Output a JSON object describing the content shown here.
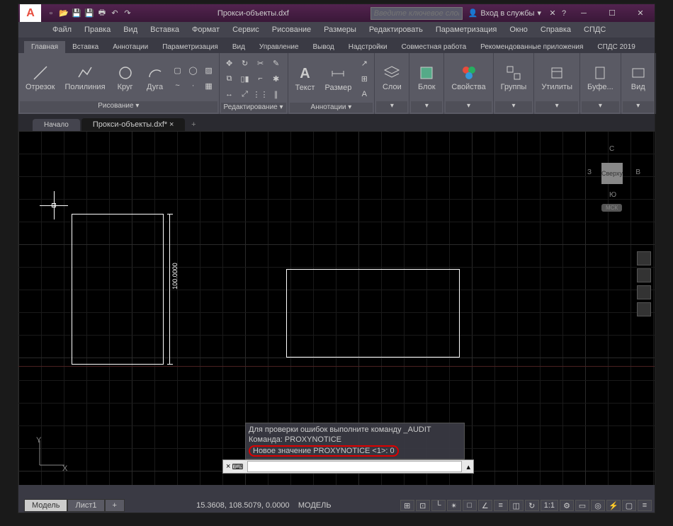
{
  "title": "Прокси-объекты.dxf",
  "search_placeholder": "Введите ключевое слово/фразу",
  "signin": "Вход в службы",
  "menubar": [
    "Файл",
    "Правка",
    "Вид",
    "Вставка",
    "Формат",
    "Сервис",
    "Рисование",
    "Размеры",
    "Редактировать",
    "Параметризация",
    "Окно",
    "Справка",
    "СПДС"
  ],
  "ribbon_tabs": [
    "Главная",
    "Вставка",
    "Аннотации",
    "Параметризация",
    "Вид",
    "Управление",
    "Вывод",
    "Надстройки",
    "Совместная работа",
    "Рекомендованные приложения",
    "СПДС 2019"
  ],
  "panels": {
    "draw": {
      "title": "Рисование ▾",
      "items": [
        "Отрезок",
        "Полилиния",
        "Круг",
        "Дуга"
      ]
    },
    "modify": {
      "title": "Редактирование ▾"
    },
    "annot": {
      "title": "Аннотации ▾",
      "items": [
        "Текст",
        "Размер"
      ]
    },
    "layers": {
      "title": "",
      "item": "Слои"
    },
    "block": {
      "title": "",
      "item": "Блок"
    },
    "props": {
      "title": "",
      "item": "Свойства"
    },
    "groups": {
      "title": "",
      "item": "Группы"
    },
    "utils": {
      "title": "",
      "item": "Утилиты"
    },
    "clipboard": {
      "title": "",
      "item": "Буфе..."
    },
    "view": {
      "title": "",
      "item": "Вид"
    }
  },
  "filetabs": {
    "start": "Начало",
    "current": "Прокси-объекты.dxf*"
  },
  "dimension_text": "100.0000",
  "viewcube": {
    "top": "С",
    "right": "В",
    "bottom": "Ю",
    "left": "З",
    "center": "Сверху",
    "wcs": "МСК"
  },
  "cmd_history": [
    "Для проверки ошибок выполните команду _AUDIT",
    "Команда: PROXYNOTICE",
    "Новое значение PROXYNOTICE <1>: 0"
  ],
  "model_tabs": [
    "Модель",
    "Лист1"
  ],
  "status_coords": "15.3608, 108.5079, 0.0000",
  "status_model": "МОДЕЛЬ",
  "status_scale": "1:1",
  "ucs_y": "Y",
  "ucs_x": "X"
}
